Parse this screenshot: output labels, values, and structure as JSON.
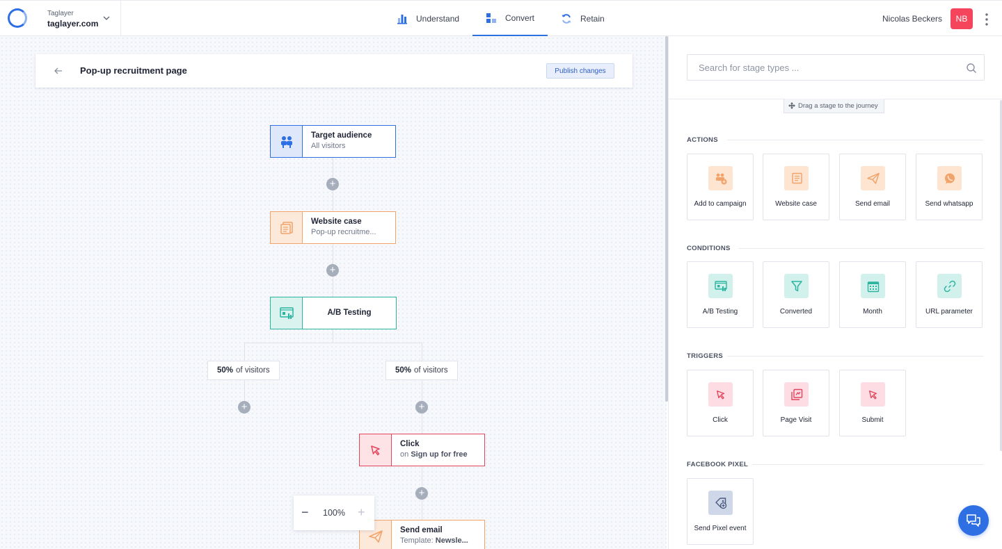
{
  "topbar": {
    "org_label": "Taglayer",
    "org_name": "taglayer.com",
    "nav": [
      {
        "label": "Understand",
        "icon": "bar-chart-icon"
      },
      {
        "label": "Convert",
        "icon": "blocks-icon",
        "active": true
      },
      {
        "label": "Retain",
        "icon": "refresh-icon"
      }
    ],
    "user_name": "Nicolas Beckers",
    "avatar_initials": "NB"
  },
  "canvas": {
    "title": "Pop-up recruitment page",
    "publish_label": "Publish changes",
    "nodes": [
      {
        "title": "Target audience",
        "subtitle": "All visitors",
        "icon": "audience-icon",
        "color": "#2f6fe4"
      },
      {
        "title": "Website case",
        "subtitle": "Pop-up recruitme...",
        "icon": "website-case-icon",
        "color": "#f1a36a"
      },
      {
        "title": "A/B Testing",
        "icon": "ab-testing-icon",
        "color": "#2bb5a0"
      },
      {
        "title": "Click",
        "sub_prefix": "on",
        "sub_value": "Sign up for free",
        "icon": "cursor-icon",
        "color": "#e2445c"
      },
      {
        "title": "Send email",
        "sub_prefix": "Template:",
        "sub_value": "Newsle...",
        "icon": "paper-plane-icon",
        "color": "#f1a36a"
      }
    ],
    "splits": [
      {
        "percent": "50%",
        "text": "of visitors"
      },
      {
        "percent": "50%",
        "text": "of visitors"
      }
    ],
    "zoom": "100%"
  },
  "panel": {
    "search_placeholder": "Search for stage types ...",
    "drag_hint": "Drag a stage to the journey",
    "sections": [
      {
        "title": "ACTIONS",
        "items": [
          {
            "label": "Add to campaign",
            "icon": "add-to-campaign-icon"
          },
          {
            "label": "Website case",
            "icon": "website-case-icon"
          },
          {
            "label": "Send email",
            "icon": "paper-plane-icon"
          },
          {
            "label": "Send whatsapp",
            "icon": "whatsapp-icon"
          }
        ]
      },
      {
        "title": "CONDITIONS",
        "items": [
          {
            "label": "A/B Testing",
            "icon": "ab-testing-icon"
          },
          {
            "label": "Converted",
            "icon": "funnel-icon"
          },
          {
            "label": "Month",
            "icon": "calendar-icon"
          },
          {
            "label": "URL parameter",
            "icon": "link-icon"
          }
        ]
      },
      {
        "title": "TRIGGERS",
        "items": [
          {
            "label": "Click",
            "icon": "cursor-icon"
          },
          {
            "label": "Page Visit",
            "icon": "page-visit-icon"
          },
          {
            "label": "Submit",
            "icon": "cursor-icon"
          }
        ]
      },
      {
        "title": "FACEBOOK PIXEL",
        "items": [
          {
            "label": "Send Pixel event",
            "icon": "pixel-tag-icon"
          }
        ]
      }
    ]
  },
  "colors": {
    "accent": "#2f6fe4",
    "avatar": "#f5455c",
    "action": "#f1a36a",
    "condition": "#2bb5a0",
    "trigger": "#e2445c",
    "pixel": "#5a6b93"
  }
}
